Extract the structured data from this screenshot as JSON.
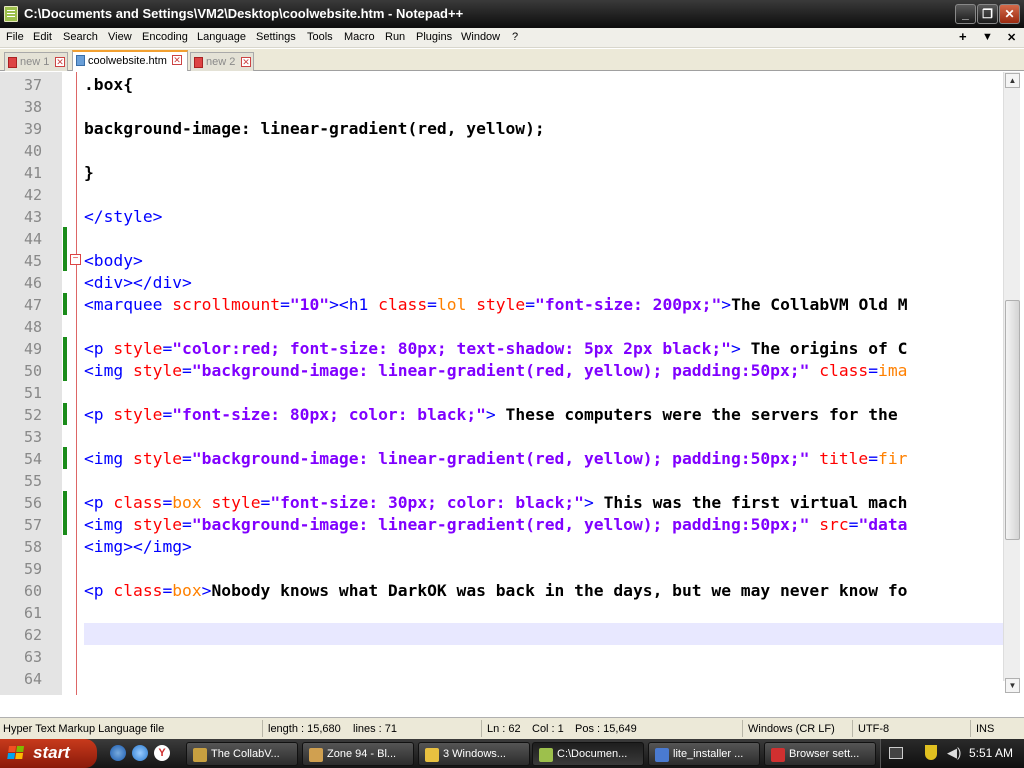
{
  "window": {
    "title": "C:\\Documents and Settings\\VM2\\Desktop\\coolwebsite.htm - Notepad++"
  },
  "menu": {
    "items": [
      "File",
      "Edit",
      "Search",
      "View",
      "Encoding",
      "Language",
      "Settings",
      "Tools",
      "Macro",
      "Run",
      "Plugins",
      "Window",
      "?"
    ],
    "right": [
      "+",
      "▼",
      "✕"
    ]
  },
  "tabs": [
    {
      "label": "new 1",
      "active": false
    },
    {
      "label": "coolwebsite.htm",
      "active": true
    },
    {
      "label": "new 2",
      "active": false
    }
  ],
  "editor": {
    "current_line": 62,
    "lines": [
      {
        "num": "37",
        "code": ".box{"
      },
      {
        "num": "38",
        "code": ""
      },
      {
        "num": "39",
        "code": "background-image: linear-gradient(red, yellow);"
      },
      {
        "num": "40",
        "code": ""
      },
      {
        "num": "41",
        "code": "}"
      },
      {
        "num": "42",
        "code": ""
      },
      {
        "num": "43",
        "code": "</style>"
      },
      {
        "num": "44",
        "code": ""
      },
      {
        "num": "45",
        "code": "<body>"
      },
      {
        "num": "46",
        "code": "<div></div>"
      },
      {
        "num": "47",
        "code": "<marquee scrollmount=\"10\"><h1 class=lol style=\"font-size: 200px;\">The CollabVM Old M"
      },
      {
        "num": "48",
        "code": ""
      },
      {
        "num": "49",
        "code": "<p style=\"color:red; font-size: 80px; text-shadow: 5px 2px black;\"> The origins of C"
      },
      {
        "num": "50",
        "code": "<img style=\"background-image: linear-gradient(red, yellow); padding:50px;\" class=ima"
      },
      {
        "num": "51",
        "code": ""
      },
      {
        "num": "52",
        "code": "<p style=\"font-size: 80px; color: black;\"> These computers were the servers for the"
      },
      {
        "num": "53",
        "code": ""
      },
      {
        "num": "54",
        "code": "<img style=\"background-image: linear-gradient(red, yellow); padding:50px;\" title=fir"
      },
      {
        "num": "55",
        "code": ""
      },
      {
        "num": "56",
        "code": "<p class=box style=\"font-size: 30px; color: black;\"> This was the first virtual mach"
      },
      {
        "num": "57",
        "code": "<img style=\"background-image: linear-gradient(red, yellow); padding:50px;\" src=\"data"
      },
      {
        "num": "58",
        "code": "<img></img>"
      },
      {
        "num": "59",
        "code": ""
      },
      {
        "num": "60",
        "code": "<p class=box>Nobody knows what DarkOK was back in the days, but we may never know fo"
      },
      {
        "num": "61",
        "code": ""
      },
      {
        "num": "62",
        "code": ""
      },
      {
        "num": "63",
        "code": ""
      },
      {
        "num": "64",
        "code": ""
      }
    ]
  },
  "status": {
    "filetype": "Hyper Text Markup Language file",
    "length": "length : 15,680",
    "lines": "lines : 71",
    "ln": "Ln : 62",
    "col": "Col : 1",
    "pos": "Pos : 15,649",
    "eol": "Windows (CR LF)",
    "encoding": "UTF-8",
    "mode": "INS"
  },
  "taskbar": {
    "start": "start",
    "tasks": [
      {
        "label": "The CollabV...",
        "color": "#c8a040"
      },
      {
        "label": "Zone 94 - Bl...",
        "color": "#d0a050"
      },
      {
        "label": "3 Windows...",
        "color": "#e8c040"
      },
      {
        "label": "C:\\Documen...",
        "color": "#9dc04c",
        "active": true
      },
      {
        "label": "lite_installer ...",
        "color": "#4a7ad0"
      },
      {
        "label": "Browser sett...",
        "color": "#d03030"
      }
    ],
    "clock": "5:51 AM"
  }
}
